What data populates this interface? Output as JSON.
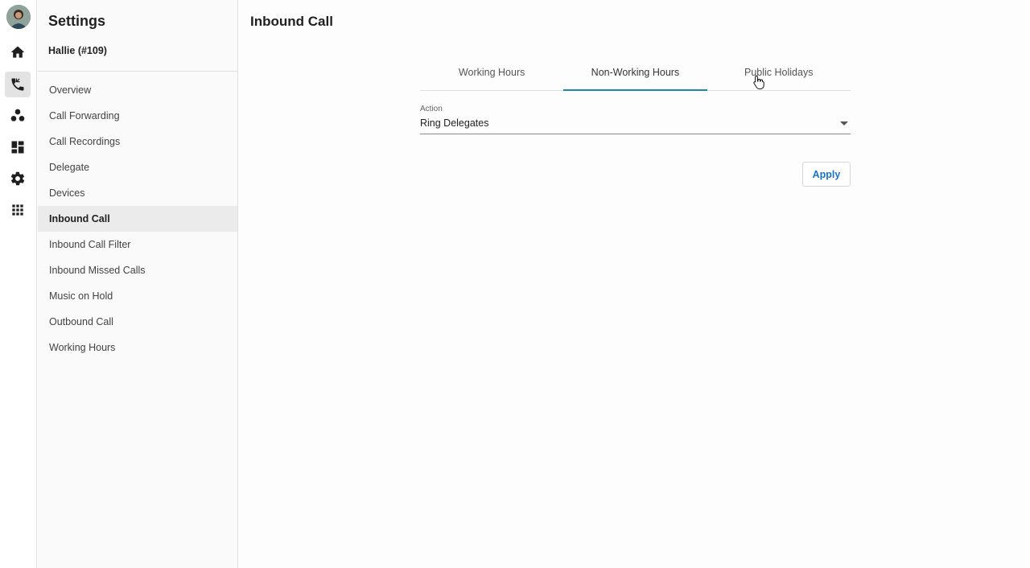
{
  "sidebar": {
    "title": "Settings",
    "user": "Hallie (#109)",
    "items": [
      {
        "label": "Overview"
      },
      {
        "label": "Call Forwarding"
      },
      {
        "label": "Call Recordings"
      },
      {
        "label": "Delegate"
      },
      {
        "label": "Devices"
      },
      {
        "label": "Inbound Call",
        "selected": true
      },
      {
        "label": "Inbound Call Filter"
      },
      {
        "label": "Inbound Missed Calls"
      },
      {
        "label": "Music on Hold"
      },
      {
        "label": "Outbound Call"
      },
      {
        "label": "Working Hours"
      }
    ]
  },
  "rail": {
    "icons": [
      "home-icon",
      "phone-icon",
      "contacts-icon",
      "dashboard-icon",
      "gear-icon",
      "apps-grid-icon"
    ],
    "active": "phone-icon"
  },
  "main": {
    "title": "Inbound Call",
    "tabs": [
      {
        "label": "Working Hours"
      },
      {
        "label": "Non-Working Hours",
        "active": true
      },
      {
        "label": "Public Holidays"
      }
    ],
    "action": {
      "label": "Action",
      "value": "Ring Delegates"
    },
    "apply_label": "Apply"
  },
  "colors": {
    "accent": "#1e88a8",
    "apply_text": "#1a73c8"
  }
}
